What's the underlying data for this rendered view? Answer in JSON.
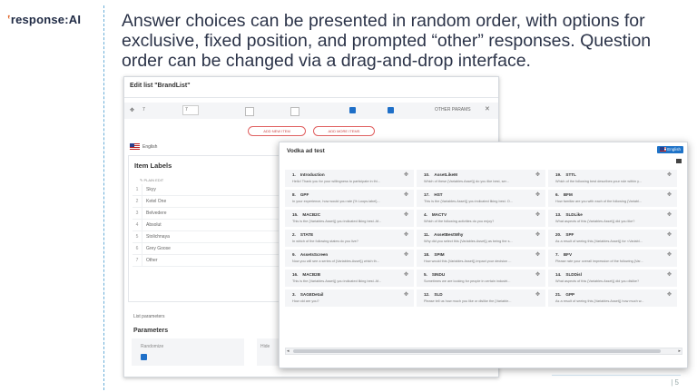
{
  "logo": {
    "mark": "ʽ",
    "text": "response:AI"
  },
  "headline": "Answer choices can be presented in random order, with options for exclusive, fixed position, and prompted “other” responses. Question order can be changed via a drag-and-drop interface.",
  "page_number": "| 5",
  "edit_window": {
    "title": "Edit list \"BrandList\"",
    "row_number": "7",
    "row_value": "7",
    "other_label": "OTHER PARAMS",
    "close_glyph": "✕",
    "add_new_item": "ADD NEW ITEM",
    "add_more_items": "ADD MORE ITEMS",
    "language": "English",
    "item_labels_title": "Item Labels",
    "plain_edit": "PLAIN EDIT",
    "items": [
      {
        "n": "1",
        "label": "Skyy"
      },
      {
        "n": "2",
        "label": "Ketel One"
      },
      {
        "n": "3",
        "label": "Belvedere"
      },
      {
        "n": "4",
        "label": "Absolut"
      },
      {
        "n": "5",
        "label": "Stolichnaya"
      },
      {
        "n": "6",
        "label": "Grey Goose"
      },
      {
        "n": "7",
        "label": "Other"
      }
    ],
    "list_parameters": "List parameters",
    "parameters_title": "Parameters",
    "randomize_label": "Randomize",
    "hide_label": "Hide"
  },
  "vodka_window": {
    "title": "Vodka ad test",
    "language": "English",
    "cards": [
      {
        "num": "1.",
        "name": "Introduction",
        "desc": "Hello! Thank you for your willingness to participate in thi..."
      },
      {
        "num": "8.",
        "name": "GPF",
        "desc": "In your experience, how would you rate {% Loops.label}..."
      },
      {
        "num": "15.",
        "name": "MACB2C",
        "desc": "This is the {Variables.Asset}} you indicated liking best. Af..."
      },
      {
        "num": "2.",
        "name": "STATE",
        "desc": "In which of the following states do you live?"
      },
      {
        "num": "9.",
        "name": "AssetsScreen",
        "desc": "Now you will see a series of {Variables.Asset}} which th..."
      },
      {
        "num": "16.",
        "name": "MACB2B",
        "desc": "This is the {Variables.Asset}} you indicated liking best. Af..."
      },
      {
        "num": "3.",
        "name": "SAGEDetail",
        "desc": "How old are you?"
      },
      {
        "num": "10.",
        "name": "AssetLikeM",
        "desc": "Which of these {Variables.Asset}} do you like best, ser..."
      },
      {
        "num": "17.",
        "name": "HST",
        "desc": "This is the {Variables.Asset}} you indicated liking best. O..."
      },
      {
        "num": "4.",
        "name": "MACTV",
        "desc": "Which of the following activities do you enjoy?"
      },
      {
        "num": "11.",
        "name": "AssetBestWhy",
        "desc": "Why did you select this {Variables.Asset}} as being the s..."
      },
      {
        "num": "18.",
        "name": "SPIM",
        "desc": "How would this {Variables.Asset}} impact your decision ..."
      },
      {
        "num": "5.",
        "name": "SINDU",
        "desc": "Sometimes we are looking for people in certain industri..."
      },
      {
        "num": "12.",
        "name": "SLD",
        "desc": "Please tell us how much you like or dislike the {Variable..."
      },
      {
        "num": "19.",
        "name": "STTL",
        "desc": "Which of the following best describes your role within y..."
      },
      {
        "num": "6.",
        "name": "BFM",
        "desc": "How familiar are you with each of the following {Variabl..."
      },
      {
        "num": "13.",
        "name": "SLDLike",
        "desc": "What aspects of this {Variables.Asset}} did you like?"
      },
      {
        "num": "20.",
        "name": "SPF",
        "desc": "As a result of seeing this {Variables.Asset}} for <Variabl..."
      },
      {
        "num": "7.",
        "name": "BFV",
        "desc": "Please rate your overall impression of the following {Var..."
      },
      {
        "num": "14.",
        "name": "SLDDisl",
        "desc": "What aspects of this {Variables.Asset}} did you dislike?"
      },
      {
        "num": "21.",
        "name": "GPP",
        "desc": "As a result of seeing this {Variables.Asset}} how much w..."
      }
    ],
    "drag_glyph": "✥"
  },
  "colors": {
    "accent": "#1e73c8",
    "button_outline": "#e06060",
    "divider": "#6aaed8",
    "logo_mark": "#e0662a"
  }
}
